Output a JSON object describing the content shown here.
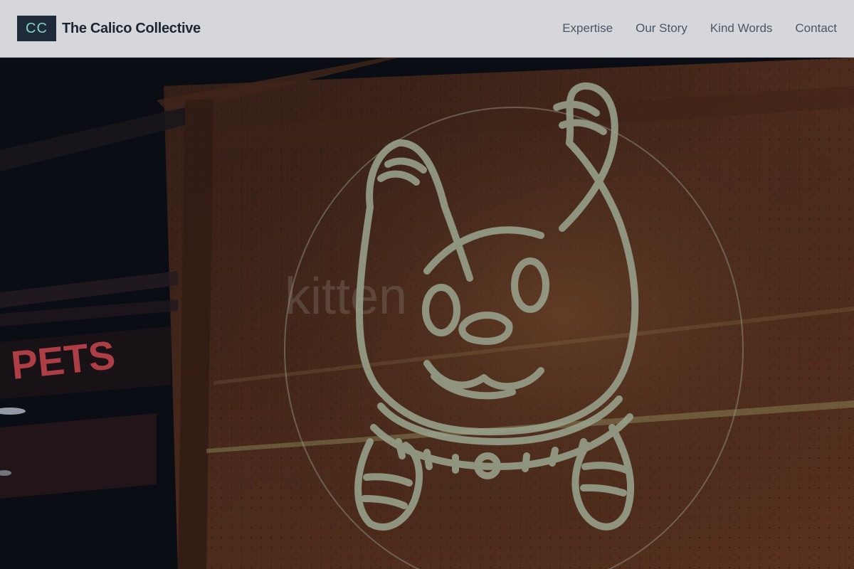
{
  "header": {
    "logo_initials": "CC",
    "brand_name": "The Calico Collective",
    "nav": [
      {
        "label": "Expertise"
      },
      {
        "label": "Our Story"
      },
      {
        "label": "Kind Words"
      },
      {
        "label": "Contact"
      }
    ]
  },
  "hero": {
    "sign_left": "PETS",
    "sign_window": "kitten"
  },
  "colors": {
    "header_bg": "#d6d7da",
    "logo_bg": "#1f2a3a",
    "logo_text": "#7fd6c2",
    "brand_text": "#1c2533",
    "nav_text": "#4a5566",
    "neon": "#b9c4a8",
    "sign_red": "#d24a52"
  }
}
